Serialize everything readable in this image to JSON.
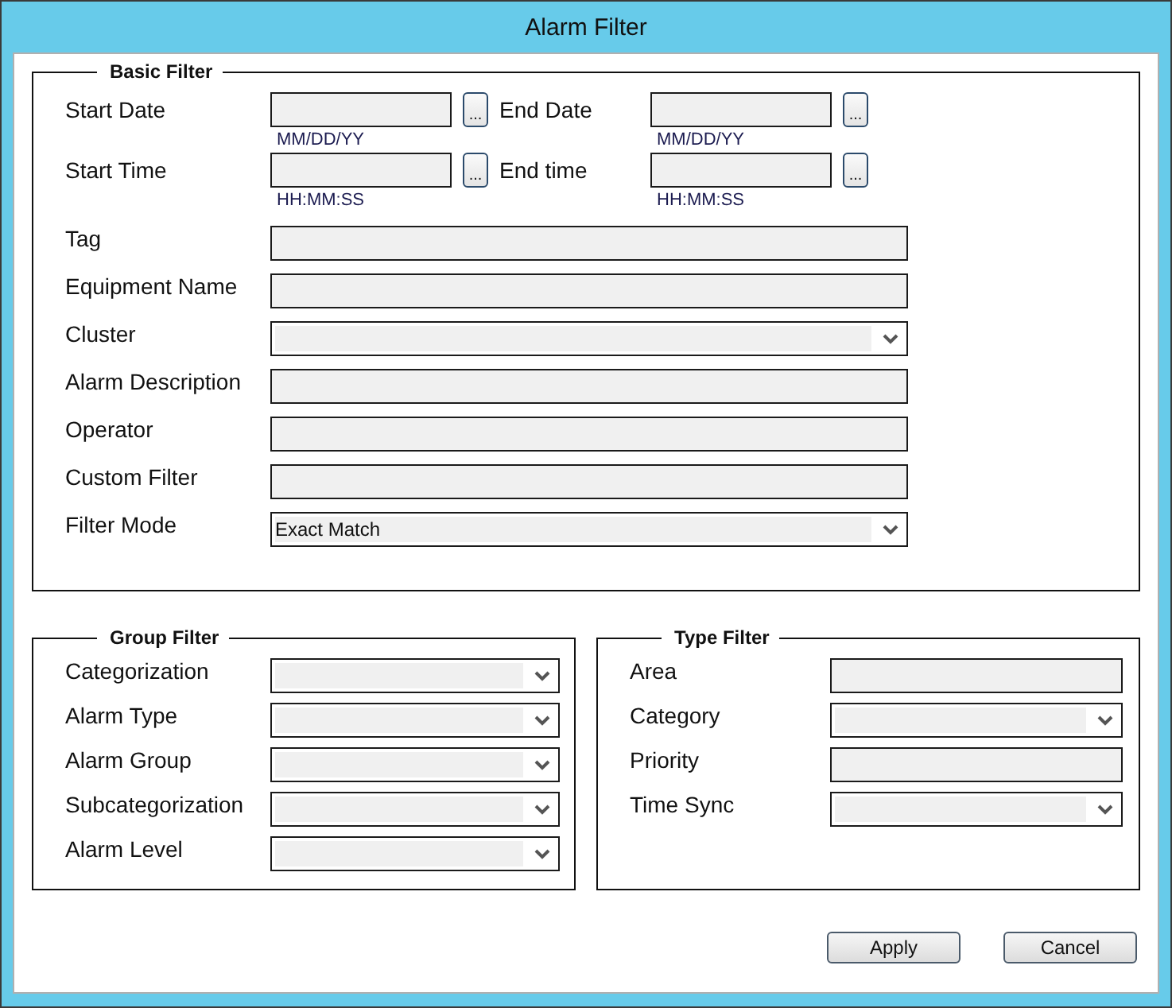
{
  "window": {
    "title": "Alarm Filter"
  },
  "basic_filter": {
    "title": "Basic Filter",
    "date_time": [
      {
        "label": "Start Date",
        "hint": "MM/DD/YY",
        "button": "..."
      },
      {
        "label": "End Date",
        "hint": "MM/DD/YY",
        "button": "..."
      },
      {
        "label": "Start Time",
        "hint": "HH:MM:SS",
        "button": "..."
      },
      {
        "label": "End time",
        "hint": "HH:MM:SS",
        "button": "..."
      }
    ],
    "fields": [
      {
        "label": "Tag",
        "kind": "text"
      },
      {
        "label": "Equipment Name",
        "kind": "text"
      },
      {
        "label": "Cluster",
        "kind": "select"
      },
      {
        "label": "Alarm Description",
        "kind": "text"
      },
      {
        "label": "Operator",
        "kind": "text"
      },
      {
        "label": "Custom Filter",
        "kind": "text"
      },
      {
        "label": "Filter Mode",
        "kind": "select",
        "value": "Exact Match"
      }
    ]
  },
  "group_filter": {
    "title": "Group Filter",
    "fields": [
      {
        "label": "Categorization",
        "kind": "select"
      },
      {
        "label": "Alarm Type",
        "kind": "select"
      },
      {
        "label": "Alarm Group",
        "kind": "select"
      },
      {
        "label": "Subcategorization",
        "kind": "select"
      },
      {
        "label": "Alarm Level",
        "kind": "select"
      }
    ]
  },
  "type_filter": {
    "title": "Type Filter",
    "fields": [
      {
        "label": "Area",
        "kind": "text"
      },
      {
        "label": "Category",
        "kind": "select"
      },
      {
        "label": "Priority",
        "kind": "text"
      },
      {
        "label": "Time Sync",
        "kind": "select"
      }
    ]
  },
  "buttons": [
    "Apply",
    "Cancel"
  ]
}
